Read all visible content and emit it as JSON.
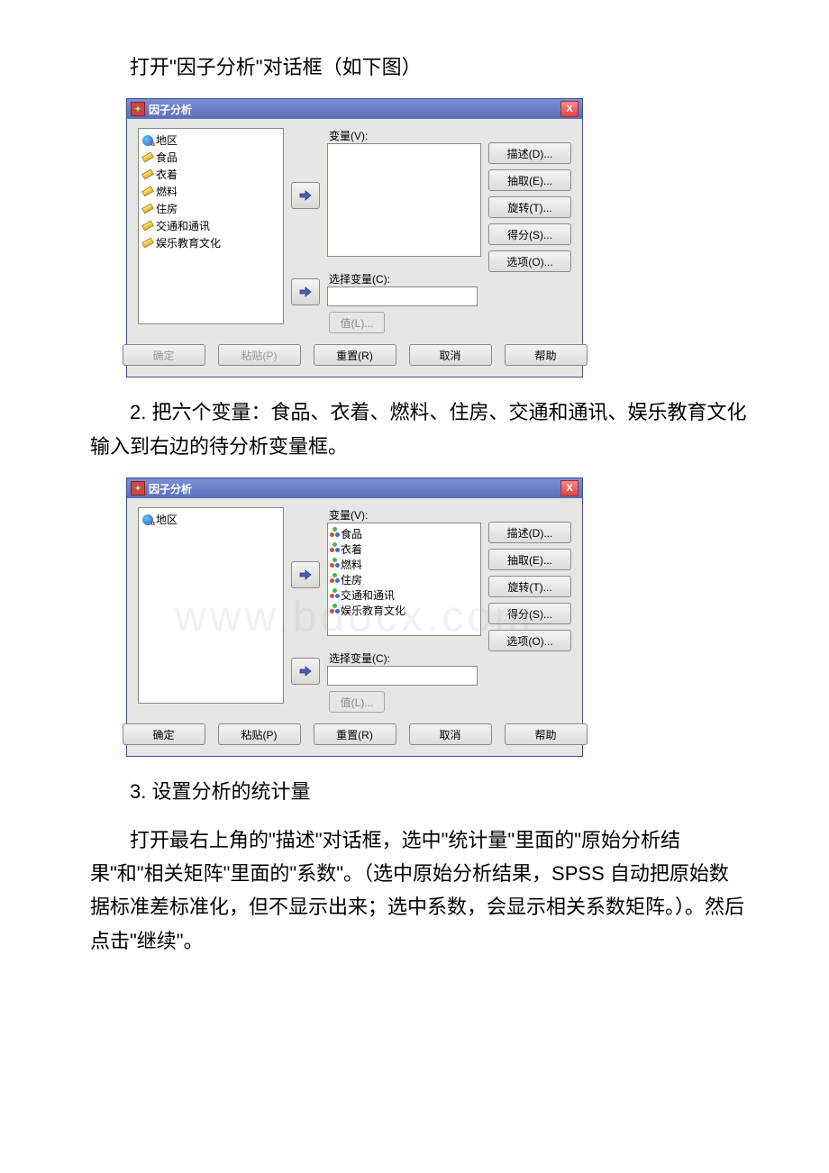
{
  "intro_text": "打开\"因子分析\"对话框（如下图）",
  "step2_text": "2. 把六个变量：食品、衣着、燃料、住房、交通和通讯、娱乐教育文化输入到右边的待分析变量框。",
  "step3a": "3. 设置分析的统计量",
  "step3b": "打开最右上角的\"描述\"对话框，选中\"统计量\"里面的\"原始分析结果\"和\"相关矩阵\"里面的\"系数\"。（选中原始分析结果，SPSS 自动把原始数据标准差标准化，但不显示出来；选中系数，会显示相关系数矩阵。）。然后点击\"继续\"。",
  "dialog": {
    "title": "因子分析",
    "close": "X",
    "var_label": "变量(V):",
    "sel_label": "选择变量(C):",
    "value_btn": "值(L)...",
    "side": {
      "describe": "描述(D)...",
      "extract": "抽取(E)...",
      "rotate": "旋转(T)...",
      "score": "得分(S)...",
      "options": "选项(O)..."
    },
    "footer": {
      "ok": "确定",
      "paste": "粘贴(P)",
      "reset": "重置(R)",
      "cancel": "取消",
      "help": "帮助"
    }
  },
  "vars": {
    "region": "地区",
    "food": "食品",
    "cloth": "衣着",
    "fuel": "燃料",
    "house": "住房",
    "trans": "交通和通讯",
    "ent": "娱乐教育文化"
  },
  "watermark": "www.bdocx.com"
}
